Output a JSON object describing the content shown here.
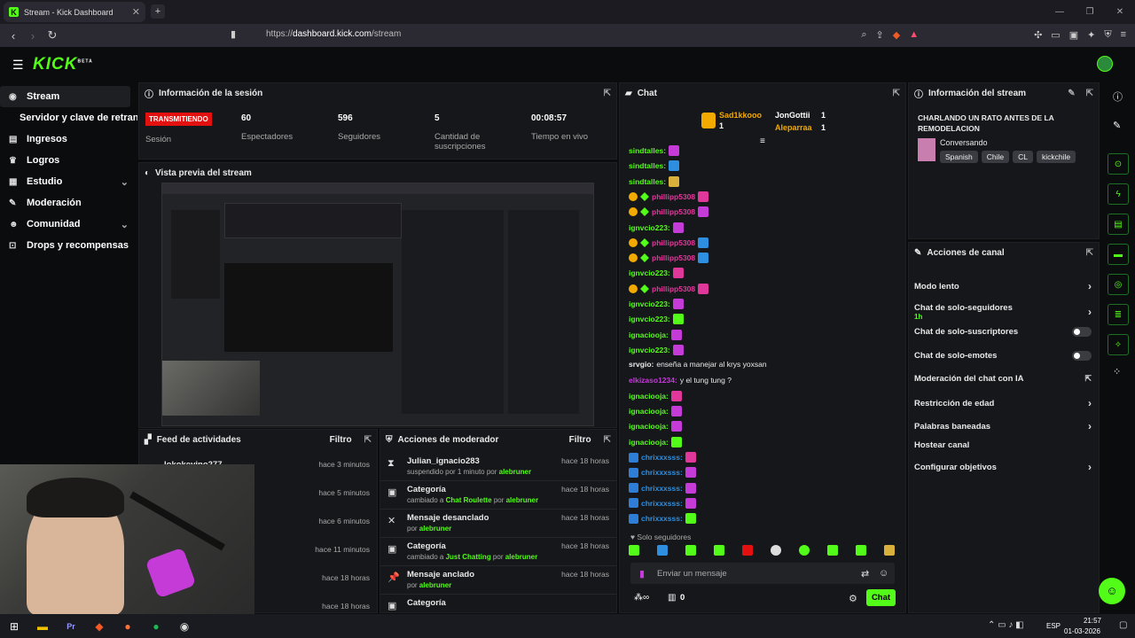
{
  "browser": {
    "tab_title": "Stream - Kick Dashboard",
    "url_prefix": "https://",
    "url_host": "dashboard.kick.com",
    "url_path": "/stream"
  },
  "brand": {
    "logo": "KICK",
    "beta": "BETA"
  },
  "sidebar": {
    "items": [
      {
        "label": "Stream"
      },
      {
        "label": "Servidor y clave de retransmisión"
      },
      {
        "label": "Ingresos"
      },
      {
        "label": "Logros"
      },
      {
        "label": "Estudio"
      },
      {
        "label": "Moderación"
      },
      {
        "label": "Comunidad"
      },
      {
        "label": "Drops y recompensas"
      }
    ]
  },
  "session": {
    "title": "Información de la sesión",
    "live_badge": "TRANSMITIENDO",
    "session_label": "Sesión",
    "stats": [
      {
        "value": "60",
        "label": "Espectadores"
      },
      {
        "value": "596",
        "label": "Seguidores"
      },
      {
        "value": "5",
        "label": "Cantidad de suscripciones"
      },
      {
        "value": "00:08:57",
        "label": "Tiempo en vivo"
      }
    ]
  },
  "preview": {
    "title": "Vista previa del stream"
  },
  "feed": {
    "title": "Feed de actividades",
    "filter": "Filtro",
    "rows": [
      {
        "name": "lokokevino277",
        "time": "hace 3 minutos"
      },
      {
        "name": "",
        "time": "hace 5 minutos"
      },
      {
        "name": "",
        "time": "hace 6 minutos"
      },
      {
        "name": "",
        "time": "hace 11 minutos"
      },
      {
        "name": "",
        "time": "hace 18 horas"
      },
      {
        "name": "",
        "time": "hace 18 horas"
      }
    ]
  },
  "modactions": {
    "title": "Acciones de moderador",
    "filter": "Filtro",
    "rows": [
      {
        "title": "Julian_ignacio283",
        "sub": "suspendido por 1 minuto por ",
        "by": "alebruner",
        "time": "hace 18 horas",
        "icon": "⧗"
      },
      {
        "title": "Categoría",
        "sub": "cambiado a ",
        "hl": "Chat Roulette",
        "sub2": " por ",
        "by": "alebruner",
        "time": "hace 18 horas",
        "icon": "▣"
      },
      {
        "title": "Mensaje desanclado",
        "sub": "por ",
        "by": "alebruner",
        "time": "hace 18 horas",
        "icon": "✕"
      },
      {
        "title": "Categoría",
        "sub": "cambiado a ",
        "hl": "Just Chatting",
        "sub2": " por ",
        "by": "alebruner",
        "time": "hace 18 horas",
        "icon": "▣"
      },
      {
        "title": "Mensaje anclado",
        "sub": "por ",
        "by": "alebruner",
        "time": "hace 18 horas",
        "icon": "📌"
      },
      {
        "title": "Categoría",
        "sub": "",
        "by": "",
        "time": "",
        "icon": "▣"
      }
    ]
  },
  "chat": {
    "title": "Chat",
    "top": [
      {
        "name": "Sad1kkooo",
        "count": "1"
      },
      {
        "name": "JonGottii",
        "count": "1"
      },
      {
        "name": "Aleparraa",
        "count": "1"
      }
    ],
    "lines": [
      {
        "user": "sindtalles:",
        "color": "#53fc18",
        "badges": "",
        "emote": "#c43bd8",
        "text": ""
      },
      {
        "user": "sindtalles:",
        "color": "#53fc18",
        "badges": "",
        "emote": "#2e8fe0",
        "text": ""
      },
      {
        "user": "sindtalles:",
        "color": "#53fc18",
        "badges": "",
        "emote": "#d8b03b",
        "text": ""
      },
      {
        "user": "phillipp5308",
        "color": "#e0379a",
        "badges": "sub",
        "emote": "#e0379a",
        "text": ""
      },
      {
        "user": "phillipp5308",
        "color": "#e0379a",
        "badges": "sub",
        "emote": "#c43bd8",
        "text": ""
      },
      {
        "user": "ignvcio223:",
        "color": "#53fc18",
        "badges": "",
        "emote": "#c43bd8",
        "text": ""
      },
      {
        "user": "phillipp5308",
        "color": "#e0379a",
        "badges": "sub",
        "emote": "#2e8fe0",
        "text": ""
      },
      {
        "user": "phillipp5308",
        "color": "#e0379a",
        "badges": "sub",
        "emote": "#2e8fe0",
        "text": ""
      },
      {
        "user": "ignvcio223:",
        "color": "#53fc18",
        "badges": "",
        "emote": "#e0379a",
        "text": ""
      },
      {
        "user": "phillipp5308",
        "color": "#e0379a",
        "badges": "sub",
        "emote": "#e0379a",
        "text": ""
      },
      {
        "user": "ignvcio223:",
        "color": "#53fc18",
        "badges": "",
        "emote": "#c43bd8",
        "text": ""
      },
      {
        "user": "ignvcio223:",
        "color": "#53fc18",
        "badges": "",
        "emote": "#53fc18",
        "text": ""
      },
      {
        "user": "ignaciooja:",
        "color": "#53fc18",
        "badges": "",
        "emote": "#c43bd8",
        "text": ""
      },
      {
        "user": "ignvcio223:",
        "color": "#53fc18",
        "badges": "",
        "emote": "#c43bd8",
        "text": ""
      },
      {
        "user": "srvgio:",
        "color": "#e9e9ea",
        "badges": "",
        "emote": "",
        "text": "enseña a manejar al krys yoxsan"
      },
      {
        "user": "elkizaso1234:",
        "color": "#c43bd8",
        "badges": "",
        "emote": "",
        "text": "y el tung tung ?"
      },
      {
        "user": "ignaciooja:",
        "color": "#53fc18",
        "badges": "",
        "emote": "#e0379a",
        "text": ""
      },
      {
        "user": "ignaciooja:",
        "color": "#53fc18",
        "badges": "",
        "emote": "#c43bd8",
        "text": ""
      },
      {
        "user": "ignaciooja:",
        "color": "#53fc18",
        "badges": "",
        "emote": "#c43bd8",
        "text": ""
      },
      {
        "user": "ignaciooja:",
        "color": "#53fc18",
        "badges": "",
        "emote": "#53fc18",
        "text": ""
      },
      {
        "user": "chrixxxsss:",
        "color": "#2e8fe0",
        "badges": "blue",
        "emote": "#e0379a",
        "text": ""
      },
      {
        "user": "chrixxxsss:",
        "color": "#2e8fe0",
        "badges": "blue",
        "emote": "#c43bd8",
        "text": ""
      },
      {
        "user": "chrixxxsss:",
        "color": "#2e8fe0",
        "badges": "blue",
        "emote": "#c43bd8",
        "text": ""
      },
      {
        "user": "chrixxxsss:",
        "color": "#2e8fe0",
        "badges": "blue",
        "emote": "#c43bd8",
        "text": ""
      },
      {
        "user": "chrixxxsss:",
        "color": "#2e8fe0",
        "badges": "blue",
        "emote": "#53fc18",
        "text": ""
      }
    ],
    "followers_only": "Solo seguidores",
    "placeholder": "Enviar un mensaje",
    "count": "0",
    "send": "Chat"
  },
  "streaminfo": {
    "title": "Información del stream",
    "stream_title": "CHARLANDO UN RATO ANTES DE LA REMODELACION",
    "category": "Conversando",
    "tags": [
      "Spanish",
      "Chile",
      "CL",
      "kickchile"
    ]
  },
  "channel": {
    "title": "Acciones de canal",
    "rows": [
      {
        "label": "Modo lento",
        "sub": "",
        "ctl": "chev"
      },
      {
        "label": "Chat de solo-seguidores",
        "sub": "1h",
        "ctl": "chev"
      },
      {
        "label": "Chat de solo-suscriptores",
        "sub": "",
        "ctl": "toggle"
      },
      {
        "label": "Chat de solo-emotes",
        "sub": "",
        "ctl": "toggle"
      },
      {
        "label": "Moderación del chat con IA",
        "sub": "",
        "ctl": "ext"
      },
      {
        "label": "Restricción de edad",
        "sub": "",
        "ctl": "chev"
      },
      {
        "label": "Palabras baneadas",
        "sub": "",
        "ctl": "chev"
      },
      {
        "label": "Hostear canal",
        "sub": "",
        "ctl": ""
      },
      {
        "label": "Configurar objetivos",
        "sub": "",
        "ctl": "chev"
      }
    ]
  },
  "taskbar": {
    "lang": "ESP",
    "time": "21:57",
    "date": "01-03-2026"
  },
  "colors": {
    "accent": "#53fc18",
    "live": "#e31010"
  }
}
